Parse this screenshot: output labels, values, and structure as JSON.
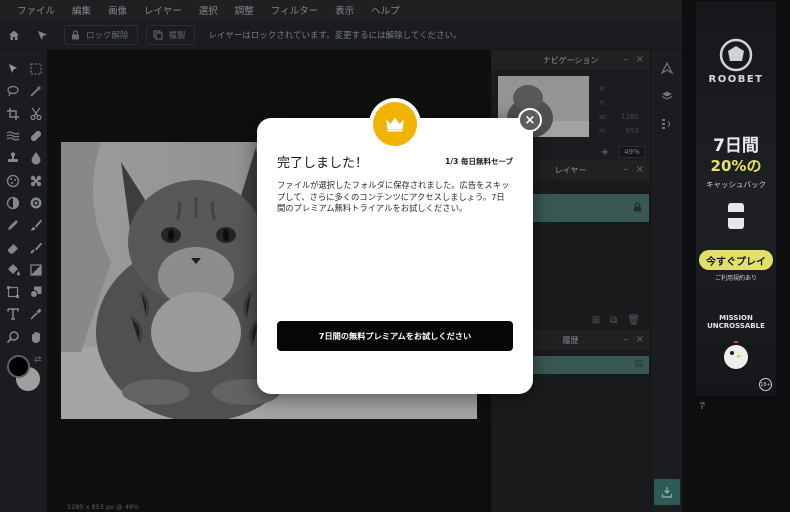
{
  "menu": [
    "ファイル",
    "編集",
    "画像",
    "レイヤー",
    "選択",
    "調整",
    "フィルター",
    "表示",
    "ヘルプ"
  ],
  "toolbar": {
    "lock_button": "ロック解除",
    "duplicate_button": "複製",
    "message": "レイヤーはロックされています。変更するには解除してください。"
  },
  "canvas": {
    "status": "1280 x 853 px @ 49%"
  },
  "navigation": {
    "title": "ナビゲーション",
    "x_label": "X:",
    "y_label": "Y:",
    "w_label": "W:",
    "w_value": "1280",
    "h_label": "H:",
    "h_value": "853",
    "zoom": "49%"
  },
  "layers": {
    "title": "レイヤー"
  },
  "history": {
    "title": "履歴"
  },
  "modal": {
    "title": "完了しました！",
    "counter": "1/3 毎日無料セーブ",
    "body": "ファイルが選択したフォルダに保存されました。広告をスキップして、さらに多くのコンテンツにアクセスしましょう。7日間のプレミアム無料トライアルをお試しください。",
    "cta": "7日間の無料プレミアムをお試しください",
    "close": "×"
  },
  "ad": {
    "brand": "ROOBET",
    "headline": "7日間",
    "percent": "20%の",
    "subline": "キャッシュバック",
    "play_button": "今すぐプレイ",
    "note": "ご利用規約あり",
    "game_title": "MISSION UNCROSSABLE",
    "age": "18+"
  },
  "colors": {
    "accent": "#4f7a73",
    "cta": "#060606",
    "crown": "#f0b400"
  }
}
